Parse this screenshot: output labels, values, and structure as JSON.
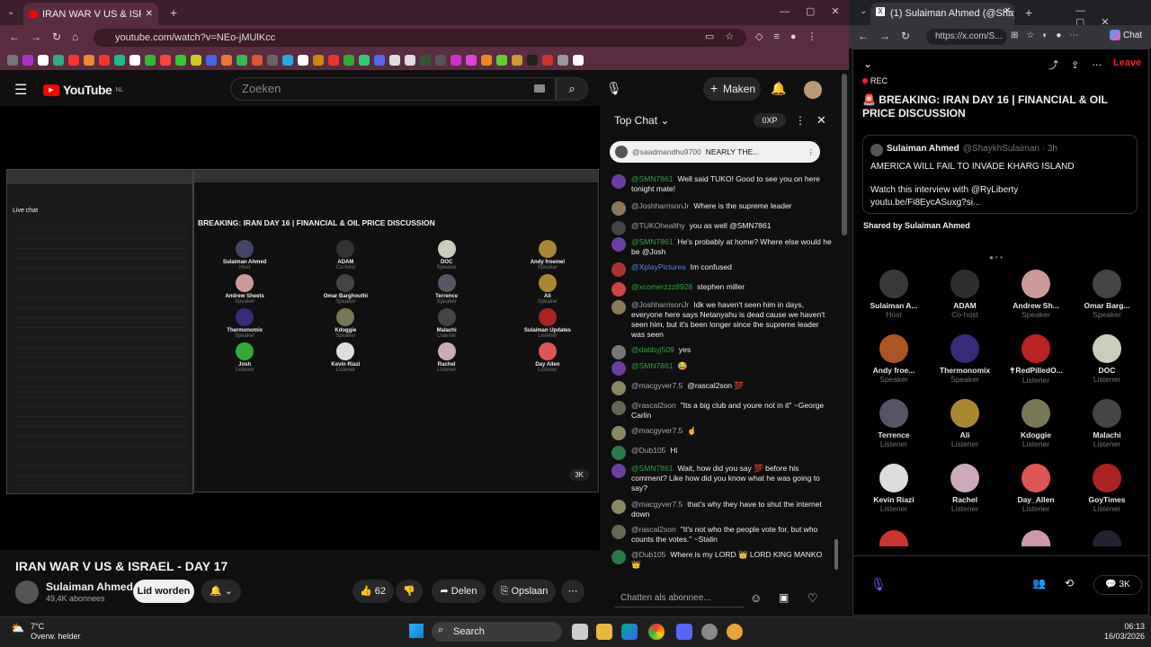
{
  "left_browser": {
    "tab_title": "IRAN WAR V US & ISRAEL",
    "url": "youtube.com/watch?v=NEo-jMUlKcc"
  },
  "youtube": {
    "logo": "YouTube",
    "region": "NL",
    "search_placeholder": "Zoeken",
    "make_label": "Maken",
    "video_title": "IRAN WAR V US & ISRAEL - DAY 17",
    "channel": "Sulaiman Ahmed",
    "subscribers": "49,4K abonnees",
    "subscribed_label": "Lid worden",
    "likes": "62",
    "share_label": "Delen",
    "save_label": "Opslaan"
  },
  "embedded_video": {
    "title": "BREAKING: IRAN DAY 16 | FINANCIAL & OIL PRICE DISCUSSION",
    "chat_label": "Live chat",
    "space_speakers": [
      {
        "name": "Sulaiman Ahmed",
        "role": "Host"
      },
      {
        "name": "ADAM",
        "role": "Co-host"
      },
      {
        "name": "DOC",
        "role": "Speaker"
      },
      {
        "name": "Andy froemel",
        "role": "Speaker"
      },
      {
        "name": "Andrew Sheets",
        "role": "Speaker"
      },
      {
        "name": "Omar Barghouthi",
        "role": "Speaker"
      },
      {
        "name": "Terrence",
        "role": "Speaker"
      },
      {
        "name": "Ali",
        "role": "Speaker"
      },
      {
        "name": "Thermonomix",
        "role": "Speaker"
      },
      {
        "name": "Kdoggie",
        "role": "Speaker"
      },
      {
        "name": "Malachi",
        "role": "Listener"
      },
      {
        "name": "Sulaiman Updates",
        "role": "Listener"
      },
      {
        "name": "Josh",
        "role": "Listener"
      },
      {
        "name": "Kevin Riazi",
        "role": "Listener"
      },
      {
        "name": "Rachel",
        "role": "Listener"
      },
      {
        "name": "Day Allen",
        "role": "Listener"
      }
    ],
    "count": "3K"
  },
  "chat": {
    "header": "Top Chat",
    "xp": "0XP",
    "pinned_user": "@saadmandhu9700",
    "pinned_text": "NEARLY THE...",
    "messages": [
      {
        "user": "@SMN7861",
        "text": "Well said TUKO! Good to see you on here tonight mate!",
        "type": "member",
        "av": "#6b3fa0"
      },
      {
        "user": "@JoshharrisonJr",
        "text": "Where is the supreme leader",
        "type": "normal",
        "av": "#8a7a5a"
      },
      {
        "user": "@TUKOhealthy",
        "text": "you as well @SMN7861",
        "type": "normal",
        "av": "#444"
      },
      {
        "user": "@SMN7861",
        "text": "He's probably at home? Where else would he be @Josh",
        "type": "member",
        "av": "#6b3fa0"
      },
      {
        "user": "@XplayPictures",
        "text": "Im confused",
        "type": "mod",
        "av": "#a33"
      },
      {
        "user": "@xcomerzzz8928",
        "text": "stephen miller",
        "type": "member",
        "av": "#c44"
      },
      {
        "user": "@JoshharrisonJr",
        "text": "Idk we haven't seen him in days, everyone here says Netanyahu is dead cause we haven't seen him, but it's been longer since the supreme leader was seen",
        "type": "normal",
        "av": "#8a7a5a"
      },
      {
        "user": "@dabbyj509",
        "text": "yes",
        "type": "member",
        "av": "#777"
      },
      {
        "user": "@SMN7861",
        "text": "😂",
        "type": "member",
        "av": "#6b3fa0"
      },
      {
        "user": "@macgyver7.5",
        "text": "@rascal2son 💯",
        "type": "normal",
        "av": "#886"
      },
      {
        "user": "@rascal2son",
        "text": "\"Its a big club and youre not in it\" ~George Carlin",
        "type": "normal",
        "av": "#665"
      },
      {
        "user": "@macgyver7.5",
        "text": "☝",
        "type": "normal",
        "av": "#886"
      },
      {
        "user": "@Dub105",
        "text": "Hi",
        "type": "normal",
        "av": "#2a7a4a"
      },
      {
        "user": "@SMN7861",
        "text": "Wait, how did you say 💯 before his comment? Like how did you know what he was going to say?",
        "type": "member",
        "av": "#6b3fa0"
      },
      {
        "user": "@macgyver7.5",
        "text": "that's why they have to shut the internet down",
        "type": "normal",
        "av": "#886"
      },
      {
        "user": "@rascal2son",
        "text": "\"It's not who the people vote for, but who counts the votes.\" ~Stalin",
        "type": "normal",
        "av": "#665"
      },
      {
        "user": "@Dub105",
        "text": "Where is my LORD 👑 LORD KING MANKO 👑",
        "type": "normal",
        "av": "#2a7a4a"
      }
    ],
    "input_placeholder": "Chatten als abonnee..."
  },
  "right_browser": {
    "tab_title": "(1) Sulaiman Ahmed (@ShaykhSula",
    "url": "https://x.com/S...",
    "chat_label": "Chat"
  },
  "x_space": {
    "rec": "REC",
    "leave": "Leave",
    "title": "🚨 BREAKING: IRAN DAY 16 | FINANCIAL & OIL PRICE DISCUSSION",
    "post_author": "Sulaiman Ahmed",
    "post_handle": "@ShaykhSulaiman · 3h",
    "post_text": "AMERICA WILL FAIL TO INVADE KHARG ISLAND",
    "post_text2": "Watch this interview with @RyLiberty",
    "post_link": "youtu.be/Fi8EycASuxg?si...",
    "shared_by": "Shared by Sulaiman Ahmed",
    "people": [
      {
        "name": "Sulaiman A...",
        "role": "Host",
        "av": "#3a3a3a"
      },
      {
        "name": "ADAM",
        "role": "Co-host",
        "av": "#2d2d2d"
      },
      {
        "name": "Andrew Sh...",
        "role": "Speaker",
        "av": "#c99"
      },
      {
        "name": "Omar Barg...",
        "role": "Speaker",
        "av": "#444"
      },
      {
        "name": "Andy froe...",
        "role": "Speaker",
        "av": "#a52"
      },
      {
        "name": "Thermonomix",
        "role": "Speaker",
        "av": "#3a2a7a"
      },
      {
        "name": "✝RedPilledO...",
        "role": "Listener",
        "av": "#b22"
      },
      {
        "name": "DOC",
        "role": "Listener",
        "av": "#ccb"
      },
      {
        "name": "Terrence",
        "role": "Listener",
        "av": "#556"
      },
      {
        "name": "Ali",
        "role": "Listener",
        "av": "#a83"
      },
      {
        "name": "Kdoggie",
        "role": "Listener",
        "av": "#775"
      },
      {
        "name": "Malachi",
        "role": "Listener",
        "av": "#444"
      },
      {
        "name": "Kevin Riazi",
        "role": "Listener",
        "av": "#ddd"
      },
      {
        "name": "Rachel",
        "role": "Listener",
        "av": "#cab"
      },
      {
        "name": "Day_Allen",
        "role": "Listener",
        "av": "#d55"
      },
      {
        "name": "GoyTimes",
        "role": "Listener",
        "av": "#a22"
      }
    ],
    "count": "3K"
  },
  "taskbar": {
    "temp": "7°C",
    "weather": "Overw. helder",
    "search": "Search",
    "time": "06:13",
    "date": "16/03/2026"
  }
}
